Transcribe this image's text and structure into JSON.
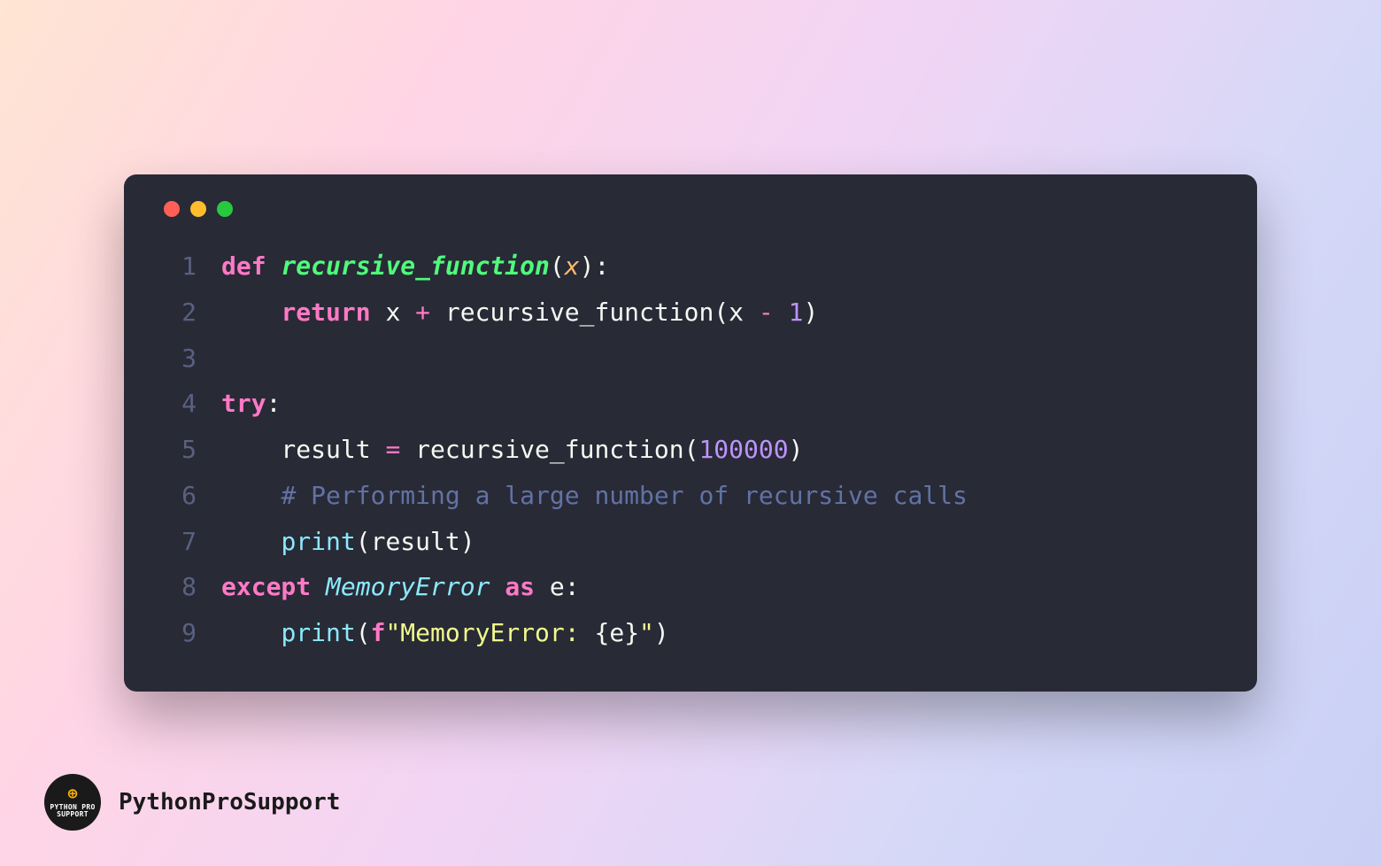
{
  "brand": {
    "name": "PythonProSupport",
    "logo_top": "PYTHON PRO",
    "logo_bottom": "SUPPORT"
  },
  "window_controls": {
    "red": "close",
    "yellow": "minimize",
    "green": "maximize"
  },
  "code": {
    "language": "python",
    "lines": [
      {
        "num": "1",
        "tokens": [
          [
            "kw",
            "def "
          ],
          [
            "fn-def",
            "recursive_function"
          ],
          [
            "punc",
            "("
          ],
          [
            "param",
            "x"
          ],
          [
            "punc",
            "):"
          ]
        ]
      },
      {
        "num": "2",
        "tokens": [
          [
            "default",
            "    "
          ],
          [
            "kw",
            "return"
          ],
          [
            "default",
            " x "
          ],
          [
            "op",
            "+"
          ],
          [
            "default",
            " recursive_function(x "
          ],
          [
            "op",
            "-"
          ],
          [
            "default",
            " "
          ],
          [
            "num",
            "1"
          ],
          [
            "default",
            ")"
          ]
        ]
      },
      {
        "num": "3",
        "tokens": []
      },
      {
        "num": "4",
        "tokens": [
          [
            "kw",
            "try"
          ],
          [
            "punc",
            ":"
          ]
        ]
      },
      {
        "num": "5",
        "tokens": [
          [
            "default",
            "    result "
          ],
          [
            "op",
            "="
          ],
          [
            "default",
            " recursive_function("
          ],
          [
            "num",
            "100000"
          ],
          [
            "default",
            ")"
          ]
        ]
      },
      {
        "num": "6",
        "tokens": [
          [
            "default",
            "    "
          ],
          [
            "comment",
            "# Performing a large number of recursive calls"
          ]
        ]
      },
      {
        "num": "7",
        "tokens": [
          [
            "default",
            "    "
          ],
          [
            "call",
            "print"
          ],
          [
            "default",
            "(result)"
          ]
        ]
      },
      {
        "num": "8",
        "tokens": [
          [
            "kw",
            "except"
          ],
          [
            "default",
            " "
          ],
          [
            "class",
            "MemoryError"
          ],
          [
            "default",
            " "
          ],
          [
            "kw",
            "as"
          ],
          [
            "default",
            " e:"
          ]
        ]
      },
      {
        "num": "9",
        "tokens": [
          [
            "default",
            "    "
          ],
          [
            "call",
            "print"
          ],
          [
            "default",
            "("
          ],
          [
            "kw",
            "f"
          ],
          [
            "str",
            "\"MemoryError: "
          ],
          [
            "punc",
            "{"
          ],
          [
            "default",
            "e"
          ],
          [
            "punc",
            "}"
          ],
          [
            "str",
            "\""
          ],
          [
            "default",
            ")"
          ]
        ]
      }
    ]
  }
}
